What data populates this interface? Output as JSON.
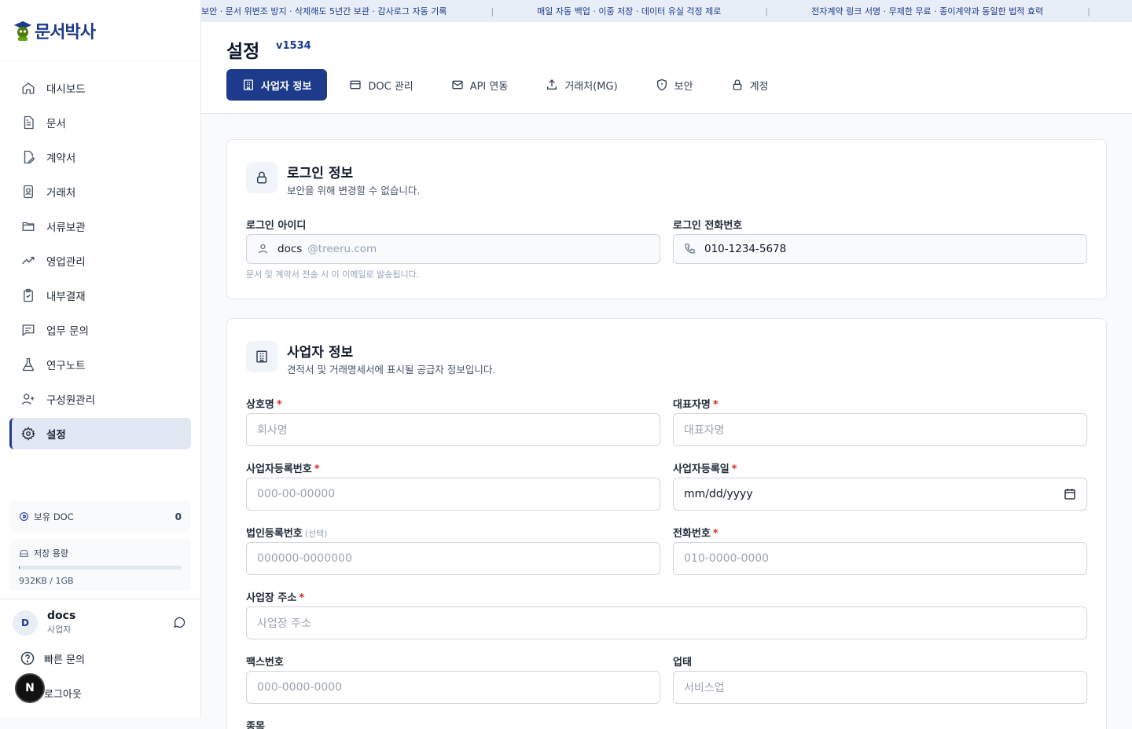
{
  "ticker": {
    "items": [
      "보안 · 문서 위변조 방지 · 삭제해도 5년간 보관 · 감사로그 자동 기록",
      "매일 자동 백업 · 이중 저장 · 데이터 유실 걱정 제로",
      "전자계약 링크 서명 · 무제한 무료 · 종이계약과 동일한 법적 효력"
    ],
    "separator": "|"
  },
  "brand": {
    "name": "문서박사"
  },
  "sidebar": {
    "items": [
      {
        "label": "대시보드",
        "icon": "home-icon"
      },
      {
        "label": "문서",
        "icon": "document-icon"
      },
      {
        "label": "계약서",
        "icon": "contract-icon"
      },
      {
        "label": "거래처",
        "icon": "contact-icon"
      },
      {
        "label": "서류보관",
        "icon": "folder-icon"
      },
      {
        "label": "영업관리",
        "icon": "trend-icon"
      },
      {
        "label": "내부결재",
        "icon": "clipboard-check-icon"
      },
      {
        "label": "업무 문의",
        "icon": "message-icon"
      },
      {
        "label": "연구노트",
        "icon": "flask-icon"
      },
      {
        "label": "구성원관리",
        "icon": "user-plus-icon"
      },
      {
        "label": "설정",
        "icon": "gear-icon",
        "active": true
      }
    ],
    "doc_balance": {
      "label": "보유 DOC",
      "count": "0"
    },
    "storage": {
      "label": "저장 용량",
      "amount": "932KB / 1GB",
      "used_fraction": 0.001
    },
    "user": {
      "initial": "D",
      "name": "docs",
      "role": "사업자"
    },
    "quick_inquiry": "빠른 문의",
    "logout": "로그아웃",
    "dev_badge": "N"
  },
  "header": {
    "title": "설정",
    "version": "v1534",
    "tabs": [
      {
        "label": "사업자 정보",
        "icon": "building-icon",
        "active": true
      },
      {
        "label": "DOC 관리",
        "icon": "card-icon"
      },
      {
        "label": "API 연동",
        "icon": "mail-icon"
      },
      {
        "label": "거래처(MG)",
        "icon": "upload-icon"
      },
      {
        "label": "보안",
        "icon": "shield-icon"
      },
      {
        "label": "계정",
        "icon": "lock-icon"
      }
    ]
  },
  "login_card": {
    "title": "로그인 정보",
    "subtitle": "보안을 위해 변경할 수 없습니다.",
    "id_label": "로그인 아이디",
    "id_value": "docs",
    "id_domain": "@treeru.com",
    "phone_label": "로그인 전화번호",
    "phone_value": "010-1234-5678",
    "hint": "문서 및 계약서 전송 시 이 이메일로 발송됩니다."
  },
  "business_card": {
    "title": "사업자 정보",
    "subtitle": "견적서 및 거래명세서에 표시될 공급자 정보입니다.",
    "required_mark": "*",
    "optional_mark": "(선택)",
    "fields": {
      "company": {
        "label": "상호명",
        "placeholder": "회사명"
      },
      "ceo": {
        "label": "대표자명",
        "placeholder": "대표자명"
      },
      "biz_no": {
        "label": "사업자등록번호",
        "placeholder": "000-00-00000"
      },
      "biz_date": {
        "label": "사업자등록일",
        "value": "mm/dd/yyyy"
      },
      "corp_no": {
        "label": "법인등록번호",
        "placeholder": "000000-0000000"
      },
      "phone": {
        "label": "전화번호",
        "placeholder": "010-0000-0000"
      },
      "address": {
        "label": "사업장 주소",
        "placeholder": "사업장 주소"
      },
      "fax": {
        "label": "팩스번호",
        "placeholder": "000-0000-0000"
      },
      "biz_type": {
        "label": "업태",
        "placeholder": "서비스업"
      },
      "biz_item": {
        "label": "종목"
      }
    }
  },
  "colors": {
    "brand": "#1e3a8a",
    "required": "#dc2626",
    "active_nav_bg": "#e2e8f3"
  }
}
